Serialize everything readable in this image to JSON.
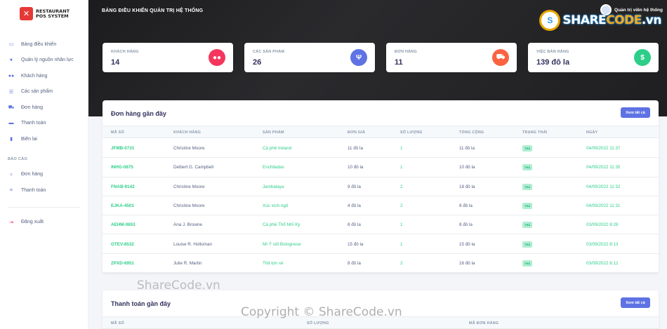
{
  "brand": {
    "line1": "RESTAURANT",
    "line2": "POS SYSTEM"
  },
  "sidebar": {
    "items": [
      {
        "label": "Bảng điều khiển",
        "icon": "monitor-icon"
      },
      {
        "label": "Quản lý nguồn nhân lực",
        "icon": "user-icon"
      },
      {
        "label": "Khách hàng",
        "icon": "users-icon"
      },
      {
        "label": "Các sản phẩm",
        "icon": "list-icon"
      },
      {
        "label": "Đơn hàng",
        "icon": "cart-icon"
      },
      {
        "label": "Thanh toán",
        "icon": "card-icon"
      },
      {
        "label": "Biên lai",
        "icon": "file-icon"
      }
    ],
    "report_heading": "BÁO CÁO",
    "report_items": [
      {
        "label": "Đơn hàng",
        "icon": "basket-icon"
      },
      {
        "label": "Thanh toán",
        "icon": "money-icon"
      }
    ],
    "logout": "Đăng xuất"
  },
  "header": {
    "title": "BẢNG ĐIỀU KHIỂN QUẢN TRỊ HỆ THỐNG",
    "user": "Quản trị viên hệ thống"
  },
  "stats": [
    {
      "label": "KHÁCH HÀNG",
      "value": "14",
      "color": "#f5365c",
      "icon": "users-icon"
    },
    {
      "label": "CÁC SẢN PHẨM",
      "value": "26",
      "color": "#5e72e4",
      "icon": "utensils-icon"
    },
    {
      "label": "ĐƠN HÀNG",
      "value": "11",
      "color": "#fb6340",
      "icon": "cart-icon"
    },
    {
      "label": "VIỆC BÁN HÀNG",
      "value": "139 đô la",
      "color": "#2dce89",
      "icon": "dollar-icon"
    }
  ],
  "orders": {
    "title": "Đơn hàng gần đây",
    "button": "Xem tất cả",
    "headers": [
      "MÃ SỐ",
      "KHÁCH HÀNG",
      "SẢN PHẨM",
      "ĐƠN GIÁ",
      "SỐ LƯỢNG",
      "TỔNG CỘNG",
      "TRẠNG THÁI",
      "NGÀY"
    ],
    "rows": [
      [
        "JFMB-0731",
        "Christine Moore",
        "Cà phê Ireland",
        "11 đô la",
        "1",
        "11 đô la",
        "TRẢ",
        "04/09/2022 11:37"
      ],
      [
        "INHG-0875",
        "Delbert G. Campbell",
        "Enchiladas",
        "10 đô la",
        "1",
        "10 đô la",
        "TRẢ",
        "04/09/2022 11:35"
      ],
      [
        "FNAB-9142",
        "Christine Moore",
        "Jambalaya",
        "9 đô la",
        "2",
        "18 đô la",
        "TRẢ",
        "04/09/2022 11:32"
      ],
      [
        "EJKA-4501",
        "Christine Moore",
        "Xúc xích ngô",
        "4 đô la",
        "2",
        "8 đô la",
        "TRẢ",
        "04/09/2022 11:31"
      ],
      [
        "AEHM-0653",
        "Ana J. Browne",
        "Cà phê Thổ Nhĩ Kỳ",
        "8 đô la",
        "1",
        "8 đô la",
        "TRẢ",
        "03/09/2022 8:26"
      ],
      [
        "OTEV-8532",
        "Louise R. Holloman",
        "Mì Ý sốt Bolognese",
        "15 đô la",
        "1",
        "15 đô la",
        "TRẢ",
        "03/09/2022 8:13"
      ],
      [
        "ZPXD-6951",
        "Julie R. Martin",
        "Thịt lợn xé",
        "8 đô la",
        "2",
        "16 đô la",
        "TRẢ",
        "03/09/2022 8:12"
      ]
    ]
  },
  "payments": {
    "title": "Thanh toán gần đây",
    "button": "Xem tất cả",
    "headers": [
      "MÃ SỐ",
      "SỐ LƯỢNG",
      "MÃ ĐƠN HÀNG"
    ]
  },
  "watermarks": {
    "logo_a": "SHARE",
    "logo_b": "CODE",
    "logo_c": ".vn",
    "mid": "ShareCode.vn",
    "bottom": "Copyright © ShareCode.vn"
  }
}
